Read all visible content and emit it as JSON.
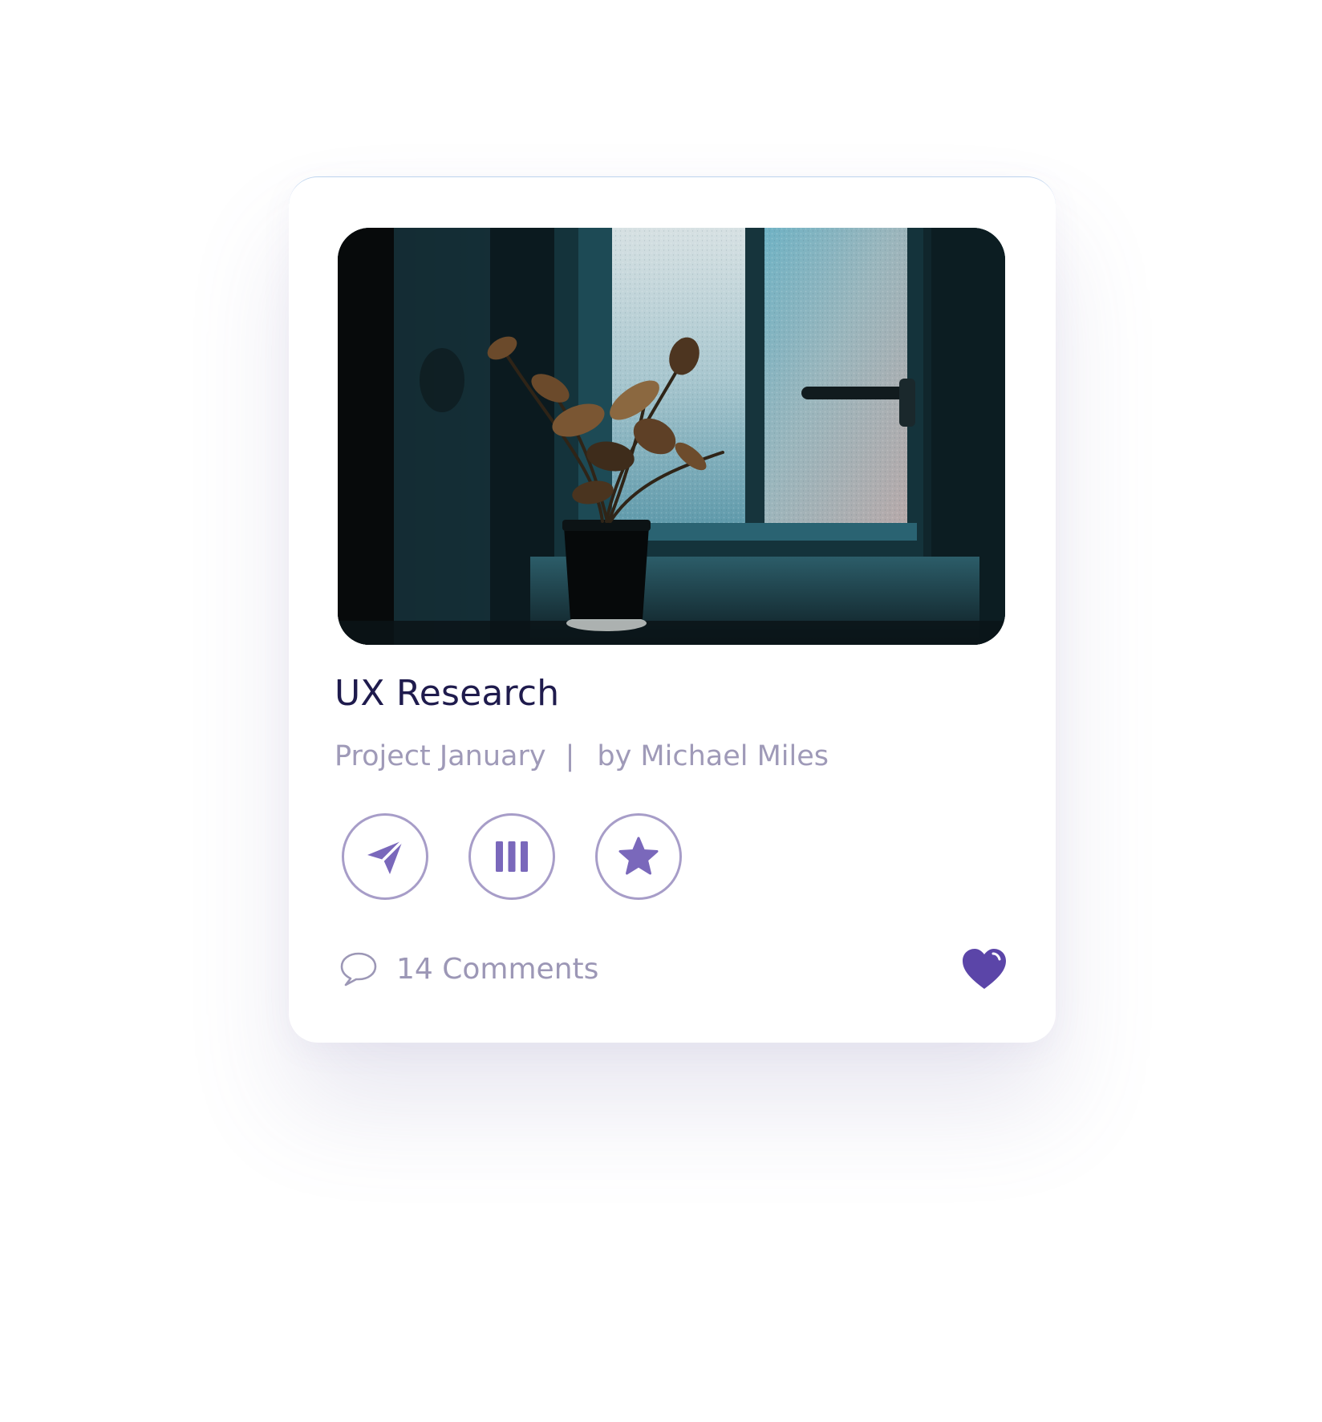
{
  "card": {
    "title": "UX Research",
    "project": "Project January",
    "separator": "|",
    "author": "by Michael Miles",
    "image_alt": "Potted plant silhouetted against a frosted window",
    "actions": [
      {
        "icon": "send-icon"
      },
      {
        "icon": "columns-icon"
      },
      {
        "icon": "star-icon"
      }
    ],
    "comments_label": "14 Comments",
    "like_icon": "heart-icon"
  },
  "colors": {
    "title": "#1f1b4d",
    "muted": "#9f9ab8",
    "accent": "#5b45a8",
    "button_border": "#a79dc8",
    "icon_fill": "#7a68bb"
  }
}
